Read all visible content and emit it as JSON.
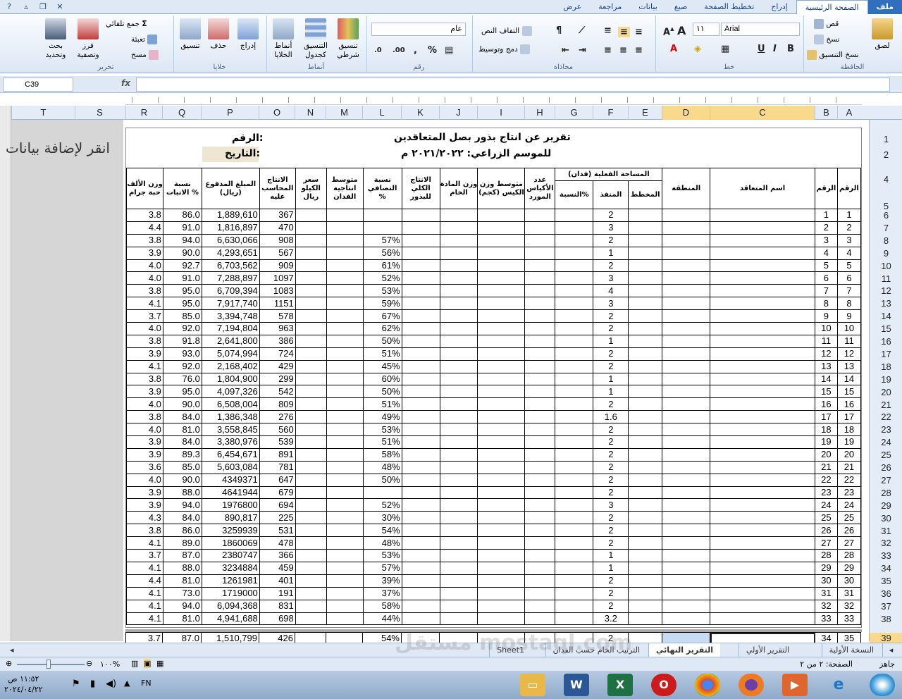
{
  "ribbon_tabs": [
    "ملف",
    "الصفحة الرئيسية",
    "إدراج",
    "تخطيط الصفحة",
    "صيغ",
    "بيانات",
    "مراجعة",
    "عرض"
  ],
  "ribbon": {
    "clipboard": {
      "paste": "لصق",
      "cut": "قص",
      "copy": "نسخ",
      "format_painter": "نسخ التنسيق",
      "label": "الحافظة"
    },
    "font": {
      "name": "Arial",
      "size": "١١",
      "label": "خط"
    },
    "alignment": {
      "wrap": "التفاف النص",
      "merge": "دمج وتوسيط",
      "label": "محاذاة"
    },
    "number": {
      "format": "عام",
      "label": "رقم"
    },
    "styles": {
      "conditional": "تنسيق شرطي",
      "as_table": "التنسيق كجدول",
      "cell_styles": "أنماط الخلايا",
      "label": "أنماط"
    },
    "cells": {
      "insert": "إدراج",
      "delete": "حذف",
      "format": "تنسيق",
      "label": "خلايا"
    },
    "editing": {
      "autosum": "جمع تلقائي",
      "fill": "تعبئة",
      "clear": "مسح",
      "sort": "فرز وتصفية",
      "find": "بحث وتحديد",
      "label": "تحرير"
    }
  },
  "formula_bar": {
    "name_box": "C39",
    "fx": "fx",
    "formula": ""
  },
  "columns": [
    "T",
    "S",
    "R",
    "Q",
    "P",
    "O",
    "N",
    "M",
    "L",
    "K",
    "J",
    "I",
    "H",
    "G",
    "F",
    "E",
    "D",
    "C",
    "B",
    "A"
  ],
  "left_pane_text": "انقر لإضافة بيانات",
  "report": {
    "title1": "تقرير عن انتاج بذور بصل المتعاقدين",
    "title2": "للموسم الزراعي: ٢٠٢١/٢٠٢٢ م",
    "label_number": "الرقم:",
    "label_date": "التاريخ:"
  },
  "headers": {
    "seq": "الرقم",
    "seq2": "الرقم",
    "name": "اسم المتعاقد",
    "region": "المنطقة",
    "area_group": "المساحة الفعلية (فدان)",
    "planned": "المخطط",
    "executed": "المنفذ",
    "pct": "النسبة%",
    "bags": "عدد الأكياس المورد",
    "avg_bag": "متوسط وزن الكيس (كجم)",
    "raw_weight": "وزن المادة الخام",
    "total_prod": "الانتاج الكلي للبذور",
    "clean_pct": "نسبة التصافي %",
    "avg_prod": "متوسط انتاجية الفدان",
    "kilo_price": "سعر الكيلو ريال",
    "accounted": "الانتاج المحاسب عليه",
    "paid": "المبلغ المدفوع (ريال)",
    "germ": "نسبة الانبات %",
    "w1000": "وزن الألف حبة جرام"
  },
  "row_numbers": [
    "1",
    "2",
    "4",
    "5",
    "6",
    "7",
    "8",
    "9",
    "10",
    "11",
    "12",
    "13",
    "14",
    "15",
    "16",
    "17",
    "18",
    "19",
    "20",
    "21",
    "22",
    "23",
    "24",
    "25",
    "26",
    "27",
    "28",
    "29",
    "30",
    "31",
    "32",
    "33",
    "34",
    "35",
    "36",
    "37",
    "38",
    "39"
  ],
  "rows": [
    {
      "a": "1",
      "b": "1",
      "f": "2",
      "l": "",
      "o": "367",
      "p": "1,889,610",
      "q": "86.0",
      "r": "3.8"
    },
    {
      "a": "2",
      "b": "2",
      "f": "3",
      "l": "",
      "o": "470",
      "p": "1,816,897",
      "q": "91.0",
      "r": "4.4"
    },
    {
      "a": "3",
      "b": "3",
      "f": "2",
      "l": "57%",
      "o": "908",
      "p": "6,630,066",
      "q": "94.0",
      "r": "3.8"
    },
    {
      "a": "4",
      "b": "4",
      "f": "1",
      "l": "56%",
      "o": "567",
      "p": "4,293,651",
      "q": "90.0",
      "r": "3.9"
    },
    {
      "a": "5",
      "b": "5",
      "f": "2",
      "l": "61%",
      "o": "909",
      "p": "6,703,562",
      "q": "92.7",
      "r": "4.0"
    },
    {
      "a": "6",
      "b": "6",
      "f": "3",
      "l": "52%",
      "o": "1097",
      "p": "7,288,897",
      "q": "91.0",
      "r": "4.0"
    },
    {
      "a": "7",
      "b": "7",
      "f": "4",
      "l": "53%",
      "o": "1083",
      "p": "6,709,394",
      "q": "95.0",
      "r": "3.8"
    },
    {
      "a": "8",
      "b": "8",
      "f": "3",
      "l": "59%",
      "o": "1151",
      "p": "7,917,740",
      "q": "95.0",
      "r": "4.1"
    },
    {
      "a": "9",
      "b": "9",
      "f": "2",
      "l": "67%",
      "o": "578",
      "p": "3,394,748",
      "q": "85.0",
      "r": "3.7"
    },
    {
      "a": "10",
      "b": "10",
      "f": "2",
      "l": "62%",
      "o": "963",
      "p": "7,194,804",
      "q": "92.0",
      "r": "4.0"
    },
    {
      "a": "11",
      "b": "11",
      "f": "1",
      "l": "50%",
      "o": "386",
      "p": "2,641,800",
      "q": "91.8",
      "r": "3.8"
    },
    {
      "a": "12",
      "b": "12",
      "f": "2",
      "l": "51%",
      "o": "724",
      "p": "5,074,994",
      "q": "93.0",
      "r": "3.9"
    },
    {
      "a": "13",
      "b": "13",
      "f": "2",
      "l": "45%",
      "o": "429",
      "p": "2,168,402",
      "q": "92.0",
      "r": "4.1"
    },
    {
      "a": "14",
      "b": "14",
      "f": "1",
      "l": "60%",
      "o": "299",
      "p": "1,804,900",
      "q": "76.0",
      "r": "3.8"
    },
    {
      "a": "15",
      "b": "15",
      "f": "1",
      "l": "50%",
      "o": "542",
      "p": "4,097,326",
      "q": "95.0",
      "r": "3.9"
    },
    {
      "a": "16",
      "b": "16",
      "f": "2",
      "l": "51%",
      "o": "809",
      "p": "6,508,004",
      "q": "90.0",
      "r": "4.0"
    },
    {
      "a": "17",
      "b": "17",
      "f": "1.6",
      "l": "49%",
      "o": "276",
      "p": "1,386,348",
      "q": "84.0",
      "r": "3.8"
    },
    {
      "a": "18",
      "b": "18",
      "f": "2",
      "l": "53%",
      "o": "560",
      "p": "3,558,845",
      "q": "81.0",
      "r": "4.0"
    },
    {
      "a": "19",
      "b": "19",
      "f": "2",
      "l": "51%",
      "o": "539",
      "p": "3,380,976",
      "q": "84.0",
      "r": "3.9"
    },
    {
      "a": "20",
      "b": "20",
      "f": "2",
      "l": "58%",
      "o": "891",
      "p": "6,454,671",
      "q": "89.3",
      "r": "3.9"
    },
    {
      "a": "21",
      "b": "21",
      "f": "2",
      "l": "48%",
      "o": "781",
      "p": "5,603,084",
      "q": "85.0",
      "r": "3.6"
    },
    {
      "a": "22",
      "b": "22",
      "f": "2",
      "l": "50%",
      "o": "647",
      "p": "4349371",
      "q": "90.0",
      "r": "4.0"
    },
    {
      "a": "23",
      "b": "23",
      "f": "2",
      "l": "",
      "o": "679",
      "p": "4641944",
      "q": "88.0",
      "r": "3.9"
    },
    {
      "a": "24",
      "b": "24",
      "f": "3",
      "l": "52%",
      "o": "694",
      "p": "1976800",
      "q": "94.0",
      "r": "3.9"
    },
    {
      "a": "25",
      "b": "25",
      "f": "2",
      "l": "30%",
      "o": "225",
      "p": "890,817",
      "q": "84.0",
      "r": "4.3"
    },
    {
      "a": "26",
      "b": "26",
      "f": "2",
      "l": "54%",
      "o": "531",
      "p": "3259939",
      "q": "86.0",
      "r": "3.8"
    },
    {
      "a": "27",
      "b": "27",
      "f": "2",
      "l": "48%",
      "o": "478",
      "p": "1860069",
      "q": "89.0",
      "r": "4.1"
    },
    {
      "a": "28",
      "b": "28",
      "f": "1",
      "l": "53%",
      "o": "366",
      "p": "2380747",
      "q": "87.0",
      "r": "3.7"
    },
    {
      "a": "29",
      "b": "29",
      "f": "1",
      "l": "57%",
      "o": "459",
      "p": "3234884",
      "q": "88.0",
      "r": "4.1"
    },
    {
      "a": "30",
      "b": "30",
      "f": "2",
      "l": "39%",
      "o": "401",
      "p": "1261981",
      "q": "81.0",
      "r": "4.4"
    },
    {
      "a": "31",
      "b": "31",
      "f": "2",
      "l": "37%",
      "o": "191",
      "p": "1719000",
      "q": "73.0",
      "r": "4.1"
    },
    {
      "a": "32",
      "b": "32",
      "f": "2",
      "l": "58%",
      "o": "831",
      "p": "6,094,368",
      "q": "94.0",
      "r": "4.1"
    },
    {
      "a": "33",
      "b": "33",
      "f": "3.2",
      "l": "44%",
      "o": "698",
      "p": "4,941,688",
      "q": "81.0",
      "r": "4.1"
    }
  ],
  "last_row": {
    "a": "35",
    "b": "34",
    "f": "2",
    "l": "54%",
    "o": "426",
    "p": "1,510,799",
    "q": "87.0",
    "r": "3.7"
  },
  "sheet_tabs": [
    "النسخة الأولية",
    "التقرير الأولي",
    "التقرير النهائي",
    "الترتيب الخام حسب الفدان",
    "Sheet1"
  ],
  "active_sheet": "التقرير النهائي",
  "status": {
    "ready": "جاهز",
    "page": "الصفحة: ٢ من ٢",
    "zoom": "١٠٠%"
  },
  "taskbar": {
    "lang": "FN",
    "time": "١١:٥٢ ص",
    "date": "٢٠٢٤/٠٤/٢٢"
  },
  "watermark": "مستقل mostaql.com"
}
